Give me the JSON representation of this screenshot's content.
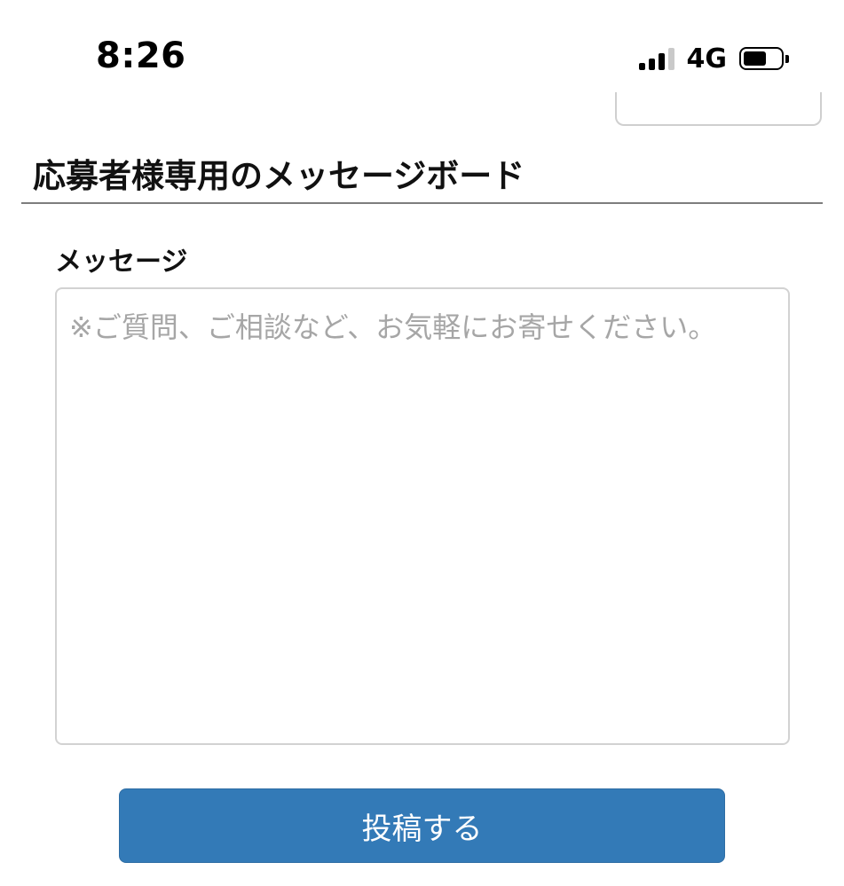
{
  "status_bar": {
    "time": "8:26",
    "network_type": "4G",
    "signal_icon": "cellular-signal-icon",
    "battery_icon": "battery-icon",
    "battery_level": 0.62
  },
  "board": {
    "title": "応募者様専用のメッセージボード"
  },
  "form": {
    "message_label": "メッセージ",
    "message_value": "",
    "message_placeholder": "※ご質問、ご相談など、お気軽にお寄せください。",
    "submit_label": "投稿する"
  },
  "colors": {
    "button_primary": "#337ab7",
    "placeholder": "#a6a6a6",
    "divider": "#7d7d7d"
  }
}
